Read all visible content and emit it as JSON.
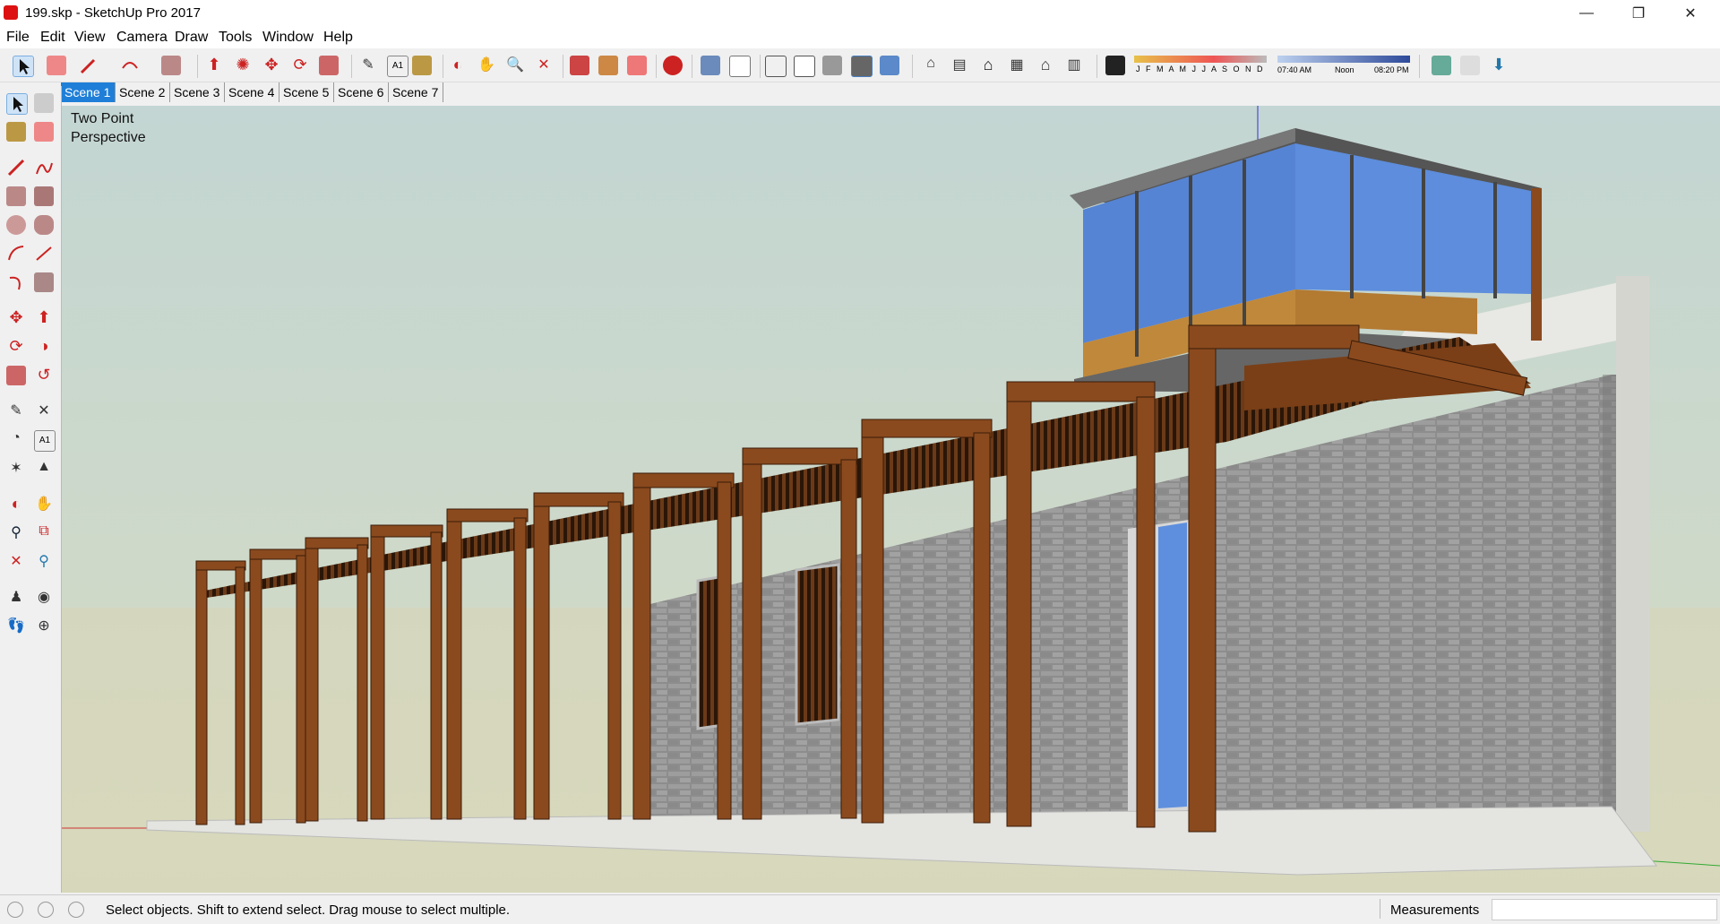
{
  "window": {
    "title": "199.skp - SketchUp Pro 2017",
    "minimize": "—",
    "maximize": "❐",
    "close": "✕"
  },
  "menu": [
    "File",
    "Edit",
    "View",
    "Camera",
    "Draw",
    "Tools",
    "Window",
    "Help"
  ],
  "toolbar": {
    "months": "J F M A M J J A S O N D",
    "time_start": "07:40 AM",
    "time_mid": "Noon",
    "time_end": "08:20 PM"
  },
  "scenes": [
    "Scene 1",
    "Scene 2",
    "Scene 3",
    "Scene 4",
    "Scene 5",
    "Scene 6",
    "Scene 7"
  ],
  "active_scene": "Scene 1",
  "viewport": {
    "camera_line1": "Two Point",
    "camera_line2": "Perspective"
  },
  "status": {
    "message": "Select objects. Shift to extend select. Drag mouse to select multiple.",
    "measurements_label": "Measurements",
    "measurements_value": ""
  },
  "colors": {
    "wood": "#8a4a1e",
    "brick": "#8e8e8e",
    "glass": "#5a86d6",
    "sky": "#c9d8d2",
    "ground": "#d9d6b8",
    "tab_active": "#1f7fd8"
  }
}
